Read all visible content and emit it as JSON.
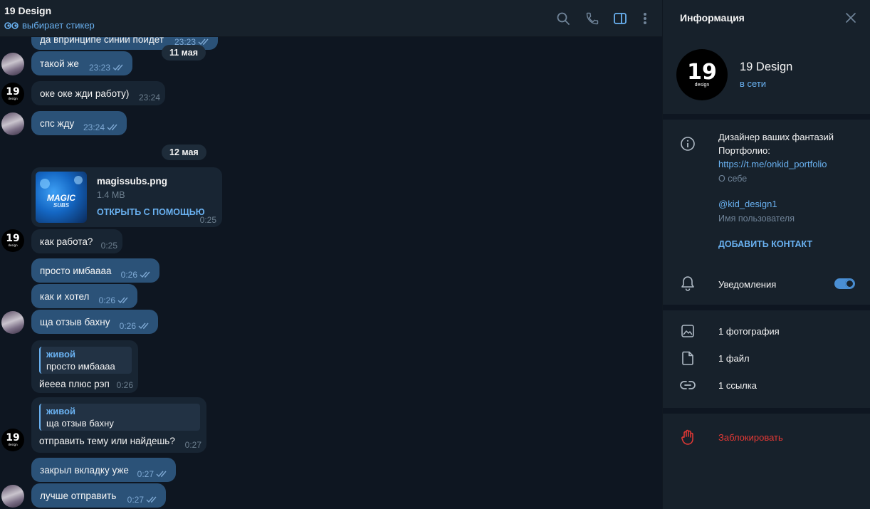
{
  "header": {
    "title": "19 Design",
    "status": "выбирает стикер",
    "icons": [
      "search-icon",
      "phone-icon",
      "sidebar-toggle-icon",
      "more-vertical-icon"
    ]
  },
  "colors": {
    "background": "#0e1621",
    "panel": "#17212b",
    "outgoing_bubble": "#2b5278",
    "incoming_bubble": "#182533",
    "accent": "#6ab2f2",
    "danger": "#e53935",
    "toggle": "#4a8fd4"
  },
  "messages": {
    "m0": {
      "text": "да впринципе синий пойдет",
      "time": "23:23"
    },
    "date1": "11 мая",
    "m1": {
      "text": "такой же",
      "time": "23:23"
    },
    "m2": {
      "text": "оке оке жди работу)",
      "time": "23:24"
    },
    "m3": {
      "text": "спс жду",
      "time": "23:24"
    },
    "date2": "12 мая",
    "file": {
      "name": "magissubs.png",
      "size": "1.4 MB",
      "action": "ОТКРЫТЬ С ПОМОЩЬЮ",
      "time": "0:25",
      "thumb_line1": "MAGIC",
      "thumb_line2": "SUBS"
    },
    "m4": {
      "text": "как работа?",
      "time": "0:25"
    },
    "m5": {
      "text": "просто имбаааа",
      "time": "0:26"
    },
    "m6": {
      "text": "как и хотел",
      "time": "0:26"
    },
    "m7": {
      "text": "ща отзыв бахну",
      "time": "0:26"
    },
    "m8": {
      "reply_name": "живой",
      "reply_text": "просто имбаааа",
      "text": "йеееа плюс рэп",
      "time": "0:26"
    },
    "m9": {
      "reply_name": "живой",
      "reply_text": "ща отзыв бахну",
      "text": "отправить тему или найдешь?",
      "time": "0:27"
    },
    "m10": {
      "text": "закрыл вкладку уже",
      "time": "0:27"
    },
    "m11": {
      "text": "лучше отправить",
      "time": "0:27"
    }
  },
  "avatar": {
    "line1": "19",
    "line2": "design"
  },
  "info": {
    "title": "Информация",
    "name": "19 Design",
    "status": "в сети",
    "bio_line1": "Дизайнер ваших фантазий",
    "bio_line2": "Портфолио:",
    "bio_link": "https://t.me/onkid_portfolio",
    "bio_label": "О себе",
    "username": "@kid_design1",
    "username_label": "Имя пользователя",
    "add_contact": "ДОБАВИТЬ КОНТАКТ",
    "notifications": "Уведомления",
    "notifications_on": true,
    "photos": "1 фотография",
    "files": "1 файл",
    "links": "1 ссылка",
    "block": "Заблокировать"
  }
}
